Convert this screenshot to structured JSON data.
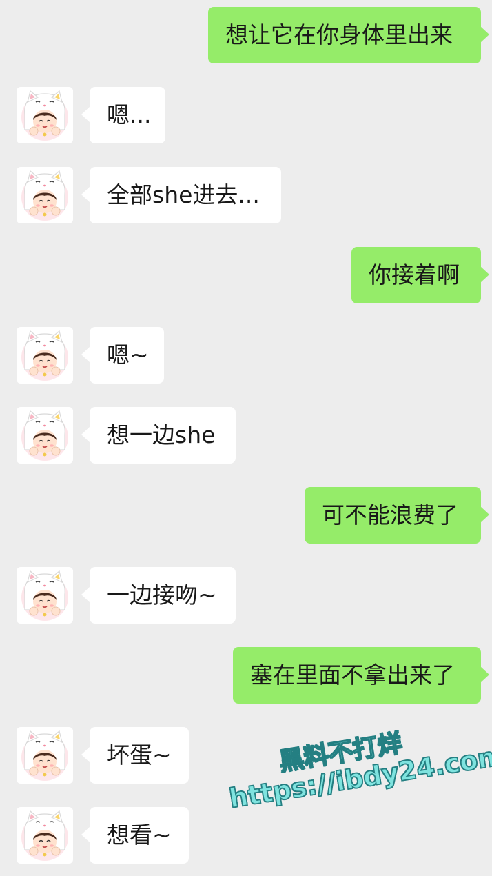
{
  "colors": {
    "background": "#ededed",
    "outgoing_bubble": "#95ec69",
    "incoming_bubble": "#ffffff",
    "watermark_fill": "#7fe3df",
    "watermark_stroke": "#247f82"
  },
  "contact": {
    "avatar_icon": "cartoon-girl-in-lucky-cat-hood"
  },
  "messages": [
    {
      "direction": "outgoing",
      "text": "想让它在你身体里出来"
    },
    {
      "direction": "incoming",
      "text": "嗯..."
    },
    {
      "direction": "incoming",
      "text": "全部she进去..."
    },
    {
      "direction": "outgoing",
      "text": "你接着啊"
    },
    {
      "direction": "incoming",
      "text": "嗯~"
    },
    {
      "direction": "incoming",
      "text": "想一边she"
    },
    {
      "direction": "outgoing",
      "text": "可不能浪费了"
    },
    {
      "direction": "incoming",
      "text": "一边接吻~"
    },
    {
      "direction": "outgoing",
      "text": "塞在里面不拿出来了"
    },
    {
      "direction": "incoming",
      "text": "坏蛋~"
    },
    {
      "direction": "incoming",
      "text": "想看~"
    }
  ],
  "watermark": {
    "line1": "黑料不打烊",
    "line2": "https://ibdy24.com"
  }
}
